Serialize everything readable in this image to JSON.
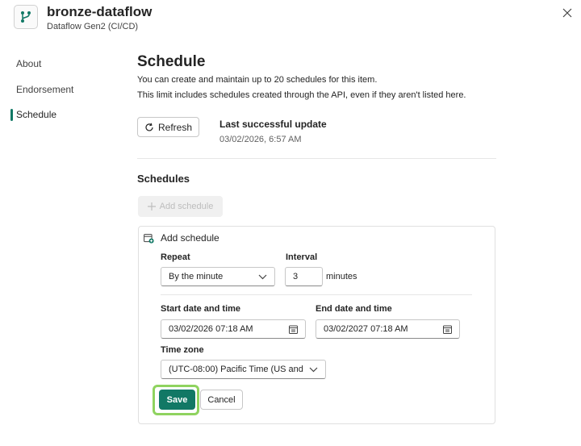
{
  "header": {
    "title": "bronze-dataflow",
    "subtitle": "Dataflow Gen2 (CI/CD)",
    "app_icon": "dataflow-icon",
    "close_icon": "close-icon"
  },
  "nav": {
    "items": [
      {
        "label": "About",
        "active": false
      },
      {
        "label": "Endorsement",
        "active": false
      },
      {
        "label": "Schedule",
        "active": true
      }
    ]
  },
  "main": {
    "title": "Schedule",
    "desc_line1": "You can create and maintain up to 20 schedules for this item.",
    "desc_line2": "This limit includes schedules created through the API, even if they aren't listed here.",
    "refresh_label": "Refresh",
    "last_update_label": "Last successful update",
    "last_update_value": "03/02/2026, 6:57 AM",
    "schedules_title": "Schedules",
    "add_schedule_button": "Add schedule"
  },
  "form": {
    "card_title": "Add schedule",
    "repeat_label": "Repeat",
    "repeat_value": "By the minute",
    "interval_label": "Interval",
    "interval_value": "3",
    "interval_unit": "minutes",
    "start_label": "Start date and time",
    "start_value": "03/02/2026 07:18 AM",
    "end_label": "End date and time",
    "end_value": "03/02/2027 07:18 AM",
    "timezone_label": "Time zone",
    "timezone_value": "(UTC-08:00) Pacific Time (US and",
    "save_label": "Save",
    "cancel_label": "Cancel"
  },
  "colors": {
    "accent": "#117865",
    "highlight": "#8fd35f"
  }
}
